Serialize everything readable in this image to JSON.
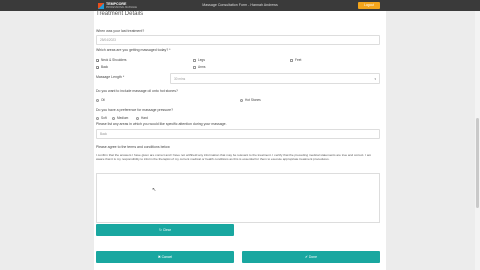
{
  "header": {
    "logo_name": "TEMPCORE",
    "logo_sub": "PROFESSIONAL MASSAGE",
    "title": "Massage Consultation Form - Hannah Andrews",
    "logout_label": "Logout"
  },
  "form": {
    "section_title": "Treatment Details",
    "last_treatment_label": "When was your last treatment?",
    "last_treatment_value": "25/04/2023",
    "areas_label": "Which areas are you getting massaged today? *",
    "areas": [
      {
        "label": "Neck & Shoulders",
        "checked": true
      },
      {
        "label": "Legs",
        "checked": false
      },
      {
        "label": "Feet",
        "checked": false
      },
      {
        "label": "Back",
        "checked": true
      },
      {
        "label": "Arms",
        "checked": false
      }
    ],
    "massage_length_label": "Massage Length *",
    "massage_length_value": "30 mins",
    "oil_label": "Do you want to include massage oil onto hot stones?",
    "oil_options": [
      {
        "label": "Oil",
        "selected": true
      },
      {
        "label": "Hot Stones",
        "selected": false
      }
    ],
    "pressure_label": "Do you have a preference for massage pressure?",
    "pressure_options": [
      {
        "label": "Soft",
        "selected": false
      },
      {
        "label": "Medium",
        "selected": true
      },
      {
        "label": "Hard",
        "selected": false
      }
    ],
    "focus_label": "Please list any areas in which you would like specific attention during your massage.",
    "focus_value": "Back",
    "terms_label": "Please agree to the terms and conditions below",
    "terms_text": "I confirm that the answers I have given are correct and I have not withheld any information that may be relevant to the treatment. I certify that the preceding medical statements are true and correct. I am aware that it is my responsibility to inform the therapist of my current medical or health conditions as this is essential for them to execute appropriate treatment procedures.",
    "clear_label": "Clear",
    "cancel_label": "Cancel",
    "done_label": "Done"
  },
  "colors": {
    "accent": "#19a7a0",
    "logout": "#f4a51c"
  }
}
